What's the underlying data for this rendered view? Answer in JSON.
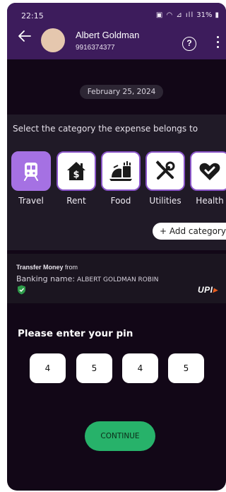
{
  "status_bar": {
    "time": "22:15",
    "battery": "31%"
  },
  "header": {
    "contact_name": "Albert Goldman",
    "contact_phone": "9916374377",
    "help_glyph": "?"
  },
  "conversation": {
    "date": "February 25, 2024"
  },
  "category": {
    "prompt": "Select the category the expense belongs to",
    "items": [
      {
        "label": "Travel",
        "icon": "train-icon",
        "selected": true
      },
      {
        "label": "Rent",
        "icon": "house-dollar-icon",
        "selected": false
      },
      {
        "label": "Food",
        "icon": "food-icon",
        "selected": false
      },
      {
        "label": "Utilities",
        "icon": "tools-icon",
        "selected": false
      },
      {
        "label": "Health",
        "icon": "heart-check-icon",
        "selected": false
      }
    ],
    "add_label": "+ Add category"
  },
  "transfer": {
    "title_bold": "Transfer Money",
    "title_rest": " from",
    "bank_label": "Banking name:",
    "bank_value": "ALBERT GOLDMAN ROBIN",
    "upi_logo": "UPI"
  },
  "pin": {
    "prompt": "Please enter your pin",
    "digits": [
      "4",
      "5",
      "4",
      "5"
    ]
  },
  "continue_label": "CONTINUE",
  "colors": {
    "header": "#3d1c5c",
    "accent": "#8a55c9",
    "selected_tile": "#a571e3",
    "continue": "#27b26a"
  }
}
